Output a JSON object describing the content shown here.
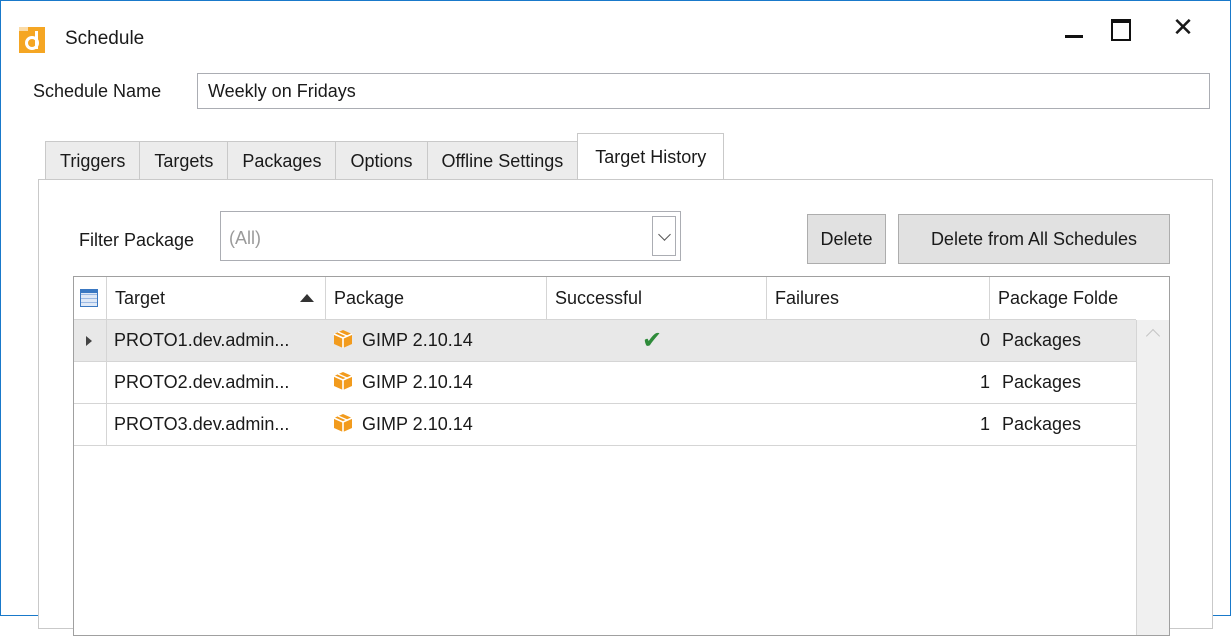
{
  "window": {
    "title": "Schedule",
    "close_glyph": "✕",
    "icons": {
      "app": "schedule-app-icon",
      "minimize": "minimize-icon",
      "maximize": "maximize-icon",
      "close": "close-icon"
    },
    "accent_color": "#1979ca",
    "app_icon_color": "#f5a623"
  },
  "schedule": {
    "name_label": "Schedule Name",
    "name_value": "Weekly on Fridays"
  },
  "tabs": [
    {
      "label": "Triggers",
      "active": false
    },
    {
      "label": "Targets",
      "active": false
    },
    {
      "label": "Packages",
      "active": false
    },
    {
      "label": "Options",
      "active": false
    },
    {
      "label": "Offline Settings",
      "active": false
    },
    {
      "label": "Target History",
      "active": true
    }
  ],
  "filter": {
    "label": "Filter Package",
    "selected_value": "(All)"
  },
  "buttons": {
    "delete": "Delete",
    "delete_all": "Delete from All Schedules"
  },
  "grid": {
    "columns": [
      "Target",
      "Package",
      "Successful",
      "Failures",
      "Package Folde"
    ],
    "sort": {
      "column": "Target",
      "direction": "ascending"
    },
    "rows": [
      {
        "target": "PROTO1.dev.admin...",
        "package": "GIMP 2.10.14",
        "successful": "✔",
        "failures": "0",
        "folder": "Packages",
        "selected": true
      },
      {
        "target": "PROTO2.dev.admin...",
        "package": "GIMP 2.10.14",
        "successful": "",
        "failures": "1",
        "folder": "Packages",
        "selected": false
      },
      {
        "target": "PROTO3.dev.admin...",
        "package": "GIMP 2.10.14",
        "successful": "",
        "failures": "1",
        "folder": "Packages",
        "selected": false
      }
    ],
    "success_color": "#2e8b3a",
    "package_icon": "package-box-icon",
    "package_icon_color": "#f29b1d"
  }
}
